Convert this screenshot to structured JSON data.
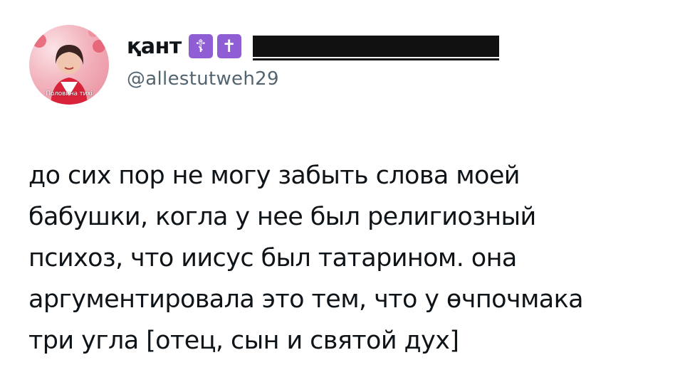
{
  "author": {
    "display_name": "қант",
    "emoji_badges": [
      "☦",
      "✝"
    ],
    "handle": "@allestutweh29",
    "avatar_caption": "Половина тихі",
    "avatar_icon": "profile-photo"
  },
  "tweet": {
    "lines": [
      "до сих пор не могу забыть слова моей",
      "бабушки, когла у нее был религиозный",
      "психоз, что иисус был татарином. она",
      "аргументировала это тем, что у өчпочмака",
      "три угла [отец, сын и святой дух]"
    ]
  },
  "colors": {
    "text": "#0f1419",
    "handle": "#536471",
    "emoji_bg": "#8f5ed4"
  }
}
